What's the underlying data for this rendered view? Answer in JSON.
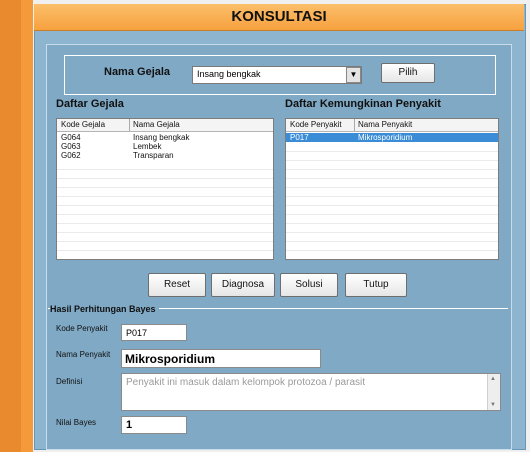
{
  "title": "KONSULTASI",
  "nama_gejala_label": "Nama Gejala",
  "combo": {
    "value": "Insang bengkak",
    "arrow": "▼"
  },
  "pilih_button": "Pilih",
  "daftar_gejala": {
    "label": "Daftar Gejala",
    "headers": [
      "Kode Gejala",
      "Nama Gejala"
    ],
    "rows": [
      [
        "G064",
        "Insang bengkak"
      ],
      [
        "G063",
        "Lembek"
      ],
      [
        "G062",
        "Transparan"
      ]
    ]
  },
  "daftar_penyakit": {
    "label": "Daftar Kemungkinan Penyakit",
    "headers": [
      "Kode Penyakit",
      "Nama Penyakit"
    ],
    "rows": [
      [
        "P017",
        "Mikrosporidium"
      ]
    ]
  },
  "buttons": {
    "reset": "Reset",
    "diagnosa": "Diagnosa",
    "solusi": "Solusi",
    "tutup": "Tutup"
  },
  "hasil": {
    "title": "Hasil Perhitungan Bayes",
    "kode_label": "Kode Penyakit",
    "kode_value": "P017",
    "nama_label": "Nama Penyakit",
    "nama_value": "Mikrosporidium",
    "definisi_label": "Definisi",
    "definisi_value": "Penyakit ini masuk dalam kelompok protozoa / parasit",
    "nilai_label": "Nilai Bayes",
    "nilai_value": "1"
  },
  "colors": {
    "orange": "#f59a3a",
    "panel_blue": "#7fa9c5",
    "selection": "#3a8cd6"
  }
}
